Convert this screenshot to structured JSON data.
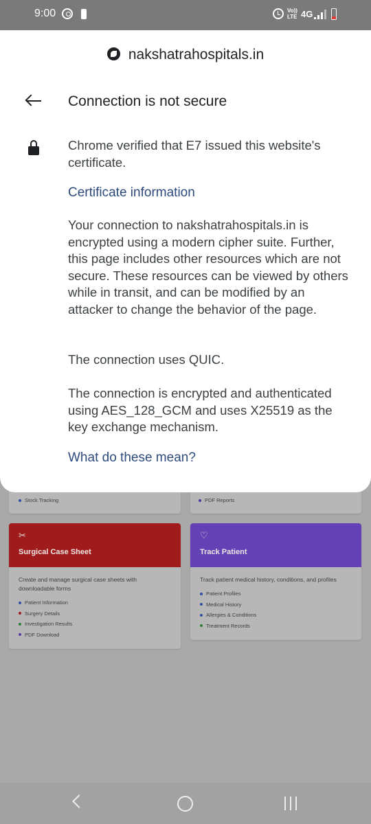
{
  "status_bar": {
    "time": "9:00",
    "volte_top": "Vo))",
    "volte_bottom": "LTE",
    "network": "4G"
  },
  "sheet": {
    "domain": "nakshatrahospitals.in",
    "title": "Connection is not secure",
    "verified_text": "Chrome verified that E7 issued this website's certificate.",
    "cert_link": "Certificate information",
    "paragraph_1": "Your connection to nakshatrahospitals.in is encrypted using a modern cipher suite. Further, this page includes other resources which are not secure. These resources can be viewed by others while in transit, and can be modified by an attacker to change the behavior of the page.",
    "paragraph_2": "The connection uses QUIC.",
    "paragraph_3": "The connection is encrypted and authenticated using AES_128_GCM and uses X25519 as the key exchange mechanism.",
    "help_link": "What do these mean?"
  },
  "background": {
    "partial_cards": [
      {
        "item": "Stock Tracking",
        "dot_color": "#2f4fa3"
      },
      {
        "item": "PDF Reports",
        "dot_color": "#4a3a9a"
      }
    ],
    "cards": [
      {
        "title": "Surgical Case Sheet",
        "icon": "scissors-icon",
        "head_color": "#a01c1c",
        "description": "Create and manage surgical case sheets with downloadable forms",
        "items": [
          {
            "label": "Patient Information",
            "dot_color": "#2f4fa3"
          },
          {
            "label": "Surgery Details",
            "dot_color": "#a01c1c"
          },
          {
            "label": "Investigation Results",
            "dot_color": "#2e7d32"
          },
          {
            "label": "PDF Download",
            "dot_color": "#5a3ea6"
          }
        ]
      },
      {
        "title": "Track Patient",
        "icon": "heart-icon",
        "head_color": "#6441b5",
        "description": "Track patient medical history, conditions, and profiles",
        "items": [
          {
            "label": "Patient Profiles",
            "dot_color": "#2f4fa3"
          },
          {
            "label": "Medical History",
            "dot_color": "#2f4fa3"
          },
          {
            "label": "Allergies & Conditions",
            "dot_color": "#2f4fa3"
          },
          {
            "label": "Treatment Records",
            "dot_color": "#2e7d32"
          }
        ]
      }
    ]
  }
}
